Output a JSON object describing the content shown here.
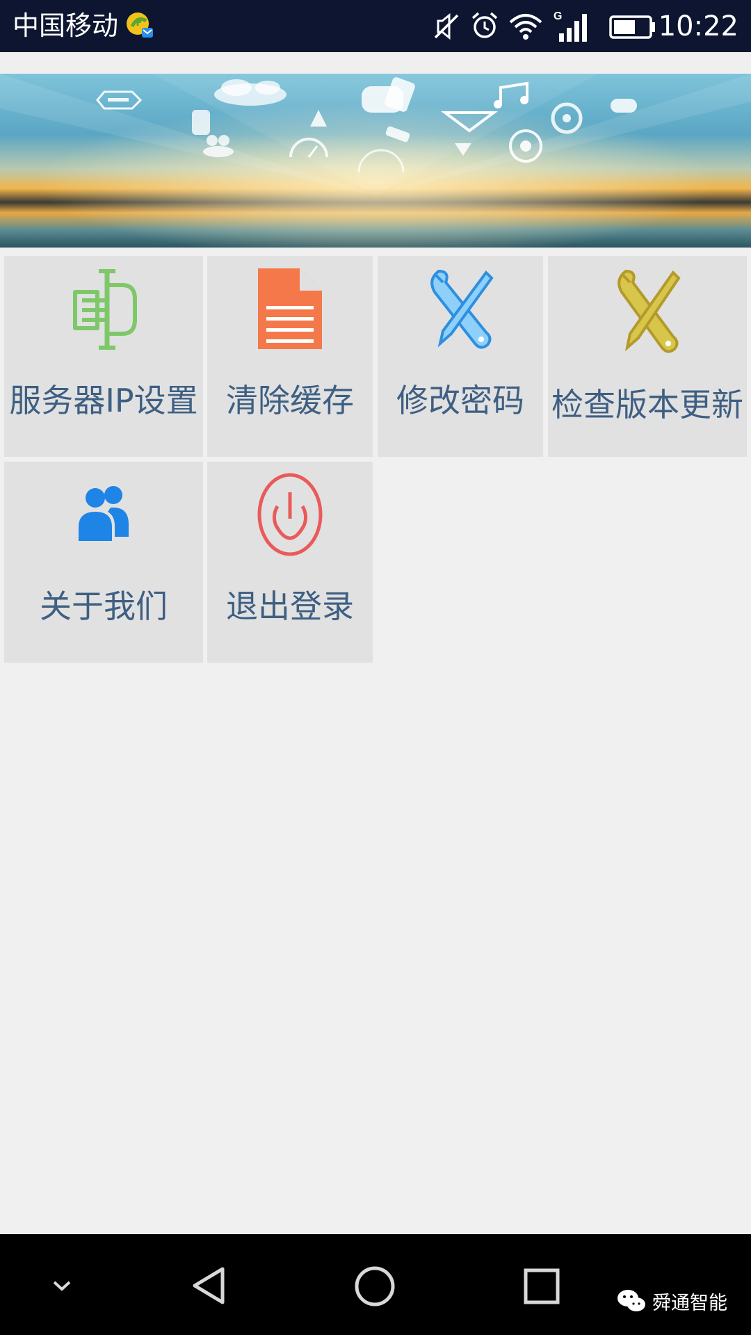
{
  "status_bar": {
    "carrier": "中国移动",
    "network_type": "G",
    "time": "10:22",
    "icons": [
      "carrier-badge-icon",
      "mute-icon",
      "alarm-icon",
      "wifi-icon",
      "signal-icon",
      "battery-icon"
    ]
  },
  "banner": {
    "icon_names": [
      "stop-sign-icon",
      "okayso-cloud-logo",
      "hand-phone-icon",
      "music-note-icon",
      "traffic-light-icon",
      "cone-icon",
      "yield-icon",
      "tire-icon",
      "people-icon",
      "speedometer-icon",
      "wheel-icon"
    ],
    "colors": {
      "sky": "#6fb8d4",
      "sunset": "#f0b24a",
      "water": "#2a5560"
    }
  },
  "menu": {
    "tiles": [
      {
        "label": "服务器IP设置",
        "icon": "server-ip-icon",
        "icon_color": "#7ec86a"
      },
      {
        "label": "清除缓存",
        "icon": "document-icon",
        "icon_color": "#f4784a"
      },
      {
        "label": "修改密码",
        "icon": "tools-icon",
        "icon_color": "#4aa3f0"
      },
      {
        "label": "检查版本更新",
        "icon": "tools-icon",
        "icon_color": "#c9b43a"
      },
      {
        "label": "关于我们",
        "icon": "people-icon",
        "icon_color": "#1e84e6"
      },
      {
        "label": "退出登录",
        "icon": "power-icon",
        "icon_color": "#ea5a5a"
      }
    ]
  },
  "nav_bar": {
    "buttons": [
      "hide-icon",
      "back-icon",
      "home-icon",
      "recents-icon"
    ]
  },
  "watermark": {
    "text": "舜通智能",
    "icon": "wechat-icon"
  }
}
